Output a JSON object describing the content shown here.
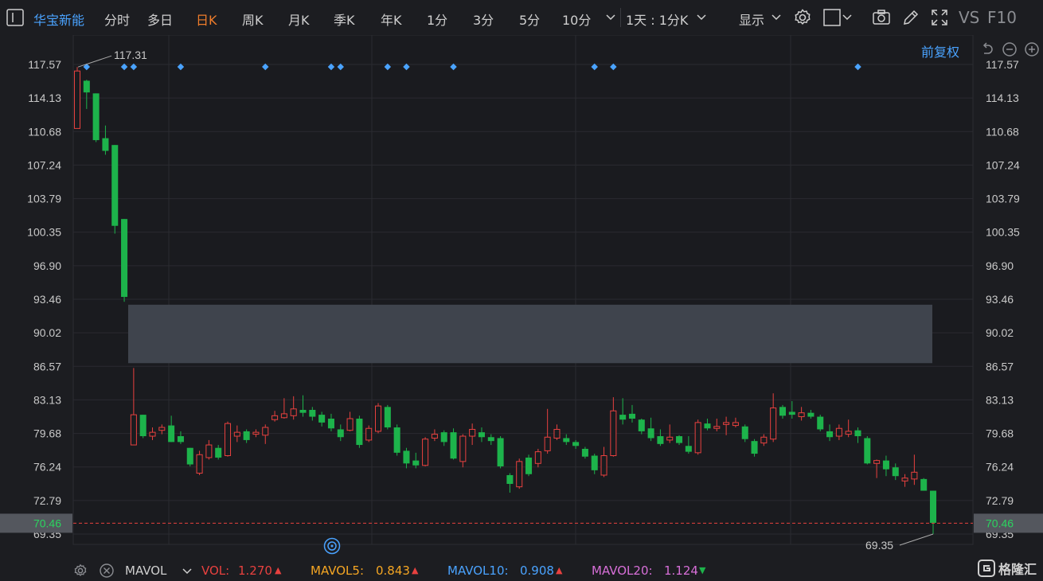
{
  "toolbar": {
    "stock_name": "华宝新能",
    "periods": [
      "分时",
      "多日",
      "日K",
      "周K",
      "月K",
      "季K",
      "年K",
      "1分",
      "3分",
      "5分",
      "10分"
    ],
    "active_period": "日K",
    "interval": "1天 : 1分K",
    "display": "显示",
    "vs": "VS",
    "f10": "F10"
  },
  "chart": {
    "adjust_label": "前复权",
    "y_ticks": [
      "117.57",
      "114.13",
      "110.68",
      "107.24",
      "103.79",
      "100.35",
      "96.90",
      "93.46",
      "90.02",
      "86.57",
      "83.13",
      "79.68",
      "76.24",
      "72.79",
      "69.35"
    ],
    "max_label": "117.31",
    "min_label": "69.35",
    "current_price": "70.46",
    "gap_zone": {
      "low": 86.9,
      "high": 92.9
    },
    "colors": {
      "up": "#e8413f",
      "down": "#1db34b",
      "current": "#e8413f",
      "gap": "#3f444d",
      "marker": "#4aa3ff"
    }
  },
  "chart_data": {
    "type": "candlestick",
    "ylim": [
      69.35,
      117.57
    ],
    "candles": [
      [
        111,
        116.9,
        117.3,
        111
      ],
      [
        115.9,
        114.7,
        116,
        113
      ],
      [
        114.6,
        109.8,
        114.6,
        109.6
      ],
      [
        110,
        108.7,
        111.3,
        108.3
      ],
      [
        109.3,
        101,
        109.3,
        100.2
      ],
      [
        101.7,
        93.7,
        101.7,
        93.2
      ],
      [
        78.5,
        81.6,
        86.4,
        78.5
      ],
      [
        81.6,
        79.4,
        81.6,
        79.2
      ],
      [
        79.4,
        79.8,
        80.3,
        79
      ],
      [
        80,
        80.3,
        80.6,
        79.6
      ],
      [
        80.5,
        78.8,
        81.5,
        78.8
      ],
      [
        79.4,
        78.8,
        79.9,
        78.6
      ],
      [
        78.2,
        76.5,
        78.2,
        76.3
      ],
      [
        75.6,
        77.5,
        77.9,
        75.4
      ],
      [
        77.2,
        78.5,
        79,
        77
      ],
      [
        78.2,
        77.2,
        78.5,
        77
      ],
      [
        77.4,
        80.7,
        80.9,
        77.3
      ],
      [
        79.4,
        79.8,
        80.5,
        78.8
      ],
      [
        79.9,
        79,
        80.1,
        78.7
      ],
      [
        79.6,
        79.8,
        80.1,
        79.3
      ],
      [
        79.5,
        80.3,
        80.6,
        78.6
      ],
      [
        81.1,
        81.5,
        82,
        80.9
      ],
      [
        81.3,
        81.7,
        83.3,
        81.2
      ],
      [
        81.5,
        82.2,
        83.5,
        81.1
      ],
      [
        82.1,
        81.8,
        83.6,
        81.4
      ],
      [
        82.1,
        81.4,
        82.4,
        81
      ],
      [
        81.6,
        80.8,
        81.9,
        80.4
      ],
      [
        81.2,
        80.2,
        81.7,
        79.9
      ],
      [
        80.1,
        79.3,
        80.6,
        78.9
      ],
      [
        80,
        81.2,
        81.9,
        79.9
      ],
      [
        81.2,
        78.5,
        81.5,
        78.2
      ],
      [
        79,
        80.2,
        80.5,
        78.8
      ],
      [
        79.9,
        82.5,
        82.8,
        79.7
      ],
      [
        82.4,
        80.3,
        82.6,
        80.1
      ],
      [
        80.3,
        77.7,
        80.6,
        77.4
      ],
      [
        77.9,
        76.6,
        78.2,
        76.1
      ],
      [
        76.9,
        76.4,
        77.7,
        76.1
      ],
      [
        76.4,
        79.1,
        79.3,
        76.3
      ],
      [
        79.2,
        79.6,
        80.1,
        78.9
      ],
      [
        79.8,
        78.8,
        80,
        78.4
      ],
      [
        79.8,
        77.1,
        80.2,
        77
      ],
      [
        76.8,
        79.4,
        79.6,
        76.2
      ],
      [
        79.4,
        80.1,
        80.7,
        78.5
      ],
      [
        79.8,
        79.3,
        80.3,
        78.8
      ],
      [
        79.3,
        78.9,
        79.6,
        78.5
      ],
      [
        79.2,
        76.3,
        79.4,
        76.1
      ],
      [
        75.4,
        74.5,
        75.6,
        73.6
      ],
      [
        74.2,
        76.8,
        77.1,
        74
      ],
      [
        77.2,
        75.5,
        77.5,
        75.3
      ],
      [
        76.6,
        77.8,
        78.1,
        76.2
      ],
      [
        77.9,
        79.3,
        82.2,
        77.6
      ],
      [
        79.2,
        80.1,
        80.6,
        79
      ],
      [
        79.2,
        78.8,
        79.6,
        78.5
      ],
      [
        78.8,
        78.4,
        79,
        78.1
      ],
      [
        78.1,
        77.3,
        78.3,
        77.1
      ],
      [
        77.4,
        75.9,
        77.6,
        75.5
      ],
      [
        75.4,
        77.4,
        78.3,
        75.2
      ],
      [
        77.4,
        82,
        83.4,
        77.3
      ],
      [
        81.6,
        81.1,
        83.3,
        80.6
      ],
      [
        81.7,
        81.2,
        82.6,
        80.8
      ],
      [
        81.1,
        79.9,
        81.2,
        79.6
      ],
      [
        80.2,
        79.2,
        81.3,
        78.9
      ],
      [
        79.4,
        78.6,
        80.1,
        78.4
      ],
      [
        79,
        79.3,
        80.6,
        78.7
      ],
      [
        79.4,
        78.7,
        79.5,
        78.5
      ],
      [
        78.4,
        77.8,
        79.4,
        77.6
      ],
      [
        77.7,
        80.8,
        81.1,
        77.5
      ],
      [
        80.7,
        80.2,
        81.2,
        80
      ],
      [
        80.2,
        80.4,
        81.2,
        79.9
      ],
      [
        80.6,
        80.8,
        81.4,
        79.5
      ],
      [
        80.5,
        80.8,
        81.3,
        80.3
      ],
      [
        80.4,
        79.1,
        80.6,
        78.8
      ],
      [
        78.9,
        77.6,
        79.1,
        77.3
      ],
      [
        78.7,
        79.3,
        79.6,
        78.4
      ],
      [
        79.1,
        82.3,
        83.8,
        78.8
      ],
      [
        82.4,
        81.5,
        82.6,
        81.2
      ],
      [
        81.9,
        81.6,
        83,
        81.2
      ],
      [
        81.4,
        81.8,
        82.4,
        81
      ],
      [
        81.8,
        81.4,
        82.1,
        81.2
      ],
      [
        81.4,
        80.1,
        81.6,
        79.9
      ],
      [
        79.9,
        79.3,
        80.6,
        78.9
      ],
      [
        79.4,
        80.2,
        80.6,
        79
      ],
      [
        79.6,
        79.9,
        81.1,
        79.3
      ],
      [
        80,
        79.4,
        80.3,
        78.7
      ],
      [
        79.2,
        76.6,
        79.4,
        76.5
      ],
      [
        76.6,
        76.9,
        77,
        75.1
      ],
      [
        76.9,
        76,
        77.4,
        75.3
      ],
      [
        76.2,
        75.3,
        76.6,
        74.9
      ],
      [
        74.8,
        75.1,
        75.5,
        74.2
      ],
      [
        75,
        75.7,
        77.5,
        74.4
      ],
      [
        75,
        73.8,
        75.1,
        73.8
      ],
      [
        73.8,
        70.5,
        73.8,
        69.35
      ]
    ],
    "markers_x_index": [
      1,
      5,
      6,
      11,
      20,
      27,
      28,
      33,
      35,
      40,
      55,
      57,
      83
    ]
  },
  "footer": {
    "indicator": "MAVOL",
    "vol_label": "VOL:",
    "vol_value": "1.270",
    "mavol5_label": "MAVOL5:",
    "mavol5_value": "0.843",
    "mavol10_label": "MAVOL10:",
    "mavol10_value": "0.908",
    "mavol20_label": "MAVOL20:",
    "mavol20_value": "1.124",
    "brand": "格隆汇",
    "colors": {
      "vol": "#e8413f",
      "mavol5": "#f5a623",
      "mavol10": "#4aa3ff",
      "mavol20": "#d76fd8"
    }
  }
}
